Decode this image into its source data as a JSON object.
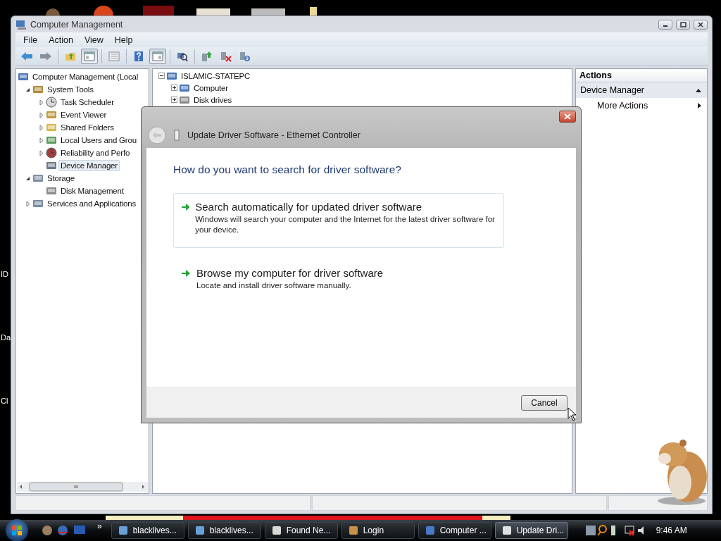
{
  "desktop": {
    "edge_labels": [
      "ID",
      "Da",
      "Cl"
    ]
  },
  "window": {
    "title": "Computer Management"
  },
  "menu": [
    "File",
    "Action",
    "View",
    "Help"
  ],
  "toolbar": [
    {
      "kind": "back",
      "pressed": false
    },
    {
      "kind": "forward",
      "pressed": false
    },
    {
      "kind": "sep"
    },
    {
      "kind": "up",
      "pressed": false
    },
    {
      "kind": "tree",
      "pressed": true
    },
    {
      "kind": "sep"
    },
    {
      "kind": "list",
      "pressed": false
    },
    {
      "kind": "sep"
    },
    {
      "kind": "help",
      "pressed": false
    },
    {
      "kind": "pane",
      "pressed": true
    },
    {
      "kind": "sep"
    },
    {
      "kind": "scan",
      "pressed": false
    },
    {
      "kind": "sep"
    },
    {
      "kind": "update",
      "pressed": false
    },
    {
      "kind": "uninstall",
      "pressed": false
    },
    {
      "kind": "disable",
      "pressed": false
    }
  ],
  "tree": [
    {
      "label": "Computer Management (Local",
      "selected": false,
      "children": [
        {
          "label": "System Tools",
          "expanded": true,
          "selected": false,
          "children": [
            {
              "label": "Task Scheduler",
              "expanded": false,
              "selected": false
            },
            {
              "label": "Event Viewer",
              "expanded": false,
              "selected": false
            },
            {
              "label": "Shared Folders",
              "expanded": false,
              "selected": false
            },
            {
              "label": "Local Users and Grou",
              "expanded": false,
              "selected": false
            },
            {
              "label": "Reliability and Perfo",
              "expanded": false,
              "selected": false
            },
            {
              "label": "Device Manager",
              "selected": true
            }
          ]
        },
        {
          "label": "Storage",
          "expanded": true,
          "selected": false,
          "children": [
            {
              "label": "Disk Management",
              "selected": false
            }
          ]
        },
        {
          "label": "Services and Applications",
          "expanded": false,
          "selected": false
        }
      ]
    }
  ],
  "devices": [
    {
      "label": "ISLAMIC-STATEPC",
      "expanded": true,
      "children": [
        {
          "label": "Computer",
          "expanded": false
        },
        {
          "label": "Disk drives",
          "expanded": false
        }
      ]
    }
  ],
  "actions": {
    "title": "Actions",
    "section": {
      "label": "Device Manager",
      "expanded": true
    },
    "items": [
      "More Actions"
    ]
  },
  "dialog": {
    "title": "Update Driver Software - Ethernet Controller",
    "heading": "How do you want to search for driver software?",
    "options": [
      {
        "title": "Search automatically for updated driver software",
        "description": "Windows will search your computer and the Internet for the latest driver software for your device.",
        "highlighted": true
      },
      {
        "title": "Browse my computer for driver software",
        "description": "Locate and install driver software manually.",
        "highlighted": false
      }
    ],
    "button": "Cancel"
  },
  "taskbar": {
    "tasks": [
      {
        "label": "blacklives...",
        "selected": false
      },
      {
        "label": "blacklives...",
        "selected": false
      },
      {
        "label": "Found Ne...",
        "selected": false
      },
      {
        "label": "Login",
        "selected": false
      },
      {
        "label": "Computer ...",
        "selected": false
      },
      {
        "label": "Update Dri...",
        "selected": true
      }
    ],
    "overflow": "»",
    "clock": "9:46 AM"
  }
}
